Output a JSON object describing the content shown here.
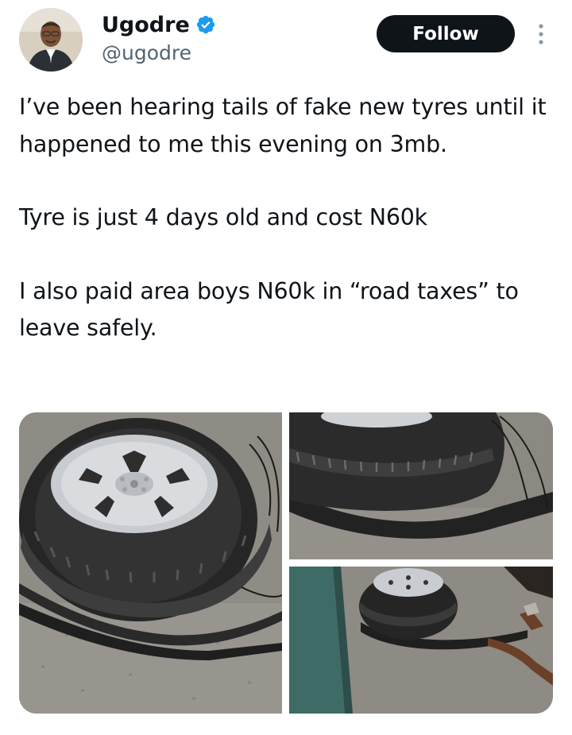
{
  "author": {
    "display_name": "Ugodre",
    "handle": "@ugodre",
    "verified_icon": "verified-badge-icon",
    "avatar_icon": "avatar-photo"
  },
  "actions": {
    "follow_label": "Follow",
    "more_icon": "more-options-icon"
  },
  "tweet": {
    "paragraphs": [
      "I’ve been hearing tails of fake new tyres until it happened to me this evening on 3mb.",
      "Tyre is just 4 days old and cost N60k",
      "I also paid area boys N60k in “road taxes” to leave safely."
    ]
  },
  "media": {
    "count": 3,
    "images": [
      "tyre-photo-1",
      "tyre-photo-2",
      "tyre-photo-3"
    ]
  },
  "colors": {
    "text": "#0f1419",
    "secondary_text": "#536471",
    "follow_bg": "#0f1419",
    "follow_text": "#ffffff",
    "verified": "#1d9bf0"
  }
}
